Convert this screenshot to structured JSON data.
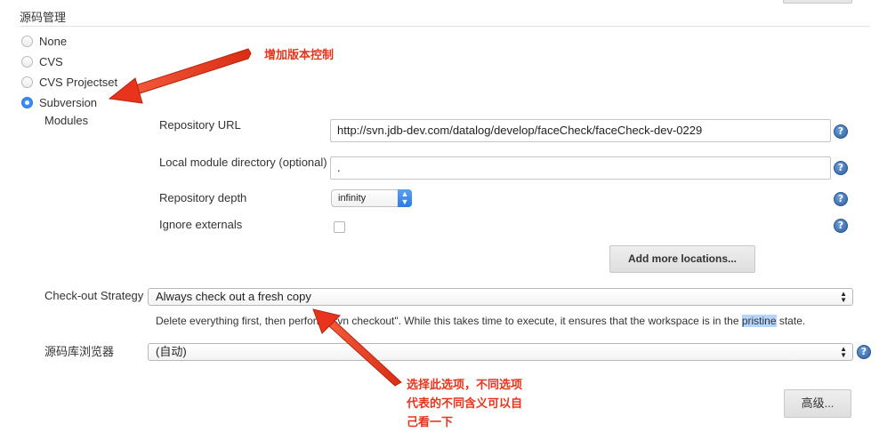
{
  "section": {
    "title": "源码管理"
  },
  "scm_options": [
    {
      "label": "None",
      "selected": false
    },
    {
      "label": "CVS",
      "selected": false
    },
    {
      "label": "CVS Projectset",
      "selected": false
    },
    {
      "label": "Subversion",
      "selected": true
    }
  ],
  "modules": {
    "label": "Modules",
    "repository_url": {
      "label": "Repository URL",
      "value": "http://svn.jdb-dev.com/datalog/develop/faceCheck/faceCheck-dev-0229"
    },
    "local_dir": {
      "label": "Local module directory (optional)",
      "value": "."
    },
    "depth": {
      "label": "Repository depth",
      "value": "infinity"
    },
    "ignore_externals": {
      "label": "Ignore externals",
      "checked": false
    },
    "add_locations_label": "Add more locations..."
  },
  "checkout": {
    "label": "Check-out Strategy",
    "value": "Always check out a fresh copy",
    "desc_before": "Delete everything first, then perform \"svn checkout\". While this takes time to execute, it ensures that the workspace is in the ",
    "desc_highlight": "pristine",
    "desc_after": " state."
  },
  "browser": {
    "label": "源码库浏览器",
    "value": "(自动)"
  },
  "advanced_label": "高级...",
  "help_glyph": "?",
  "annotations": {
    "top": "增加版本控制",
    "bottom_line1": "选择此选项，不同选项",
    "bottom_line2": "代表的不同含义可以自",
    "bottom_line3": "己看一下"
  },
  "colors": {
    "annotation_red": "#e8341c",
    "radio_blue": "#3b8cf0",
    "highlight": "#b5d5ff"
  },
  "icons": [
    "help-icon",
    "radio-icon",
    "select-arrows-icon",
    "annotation-arrow"
  ]
}
